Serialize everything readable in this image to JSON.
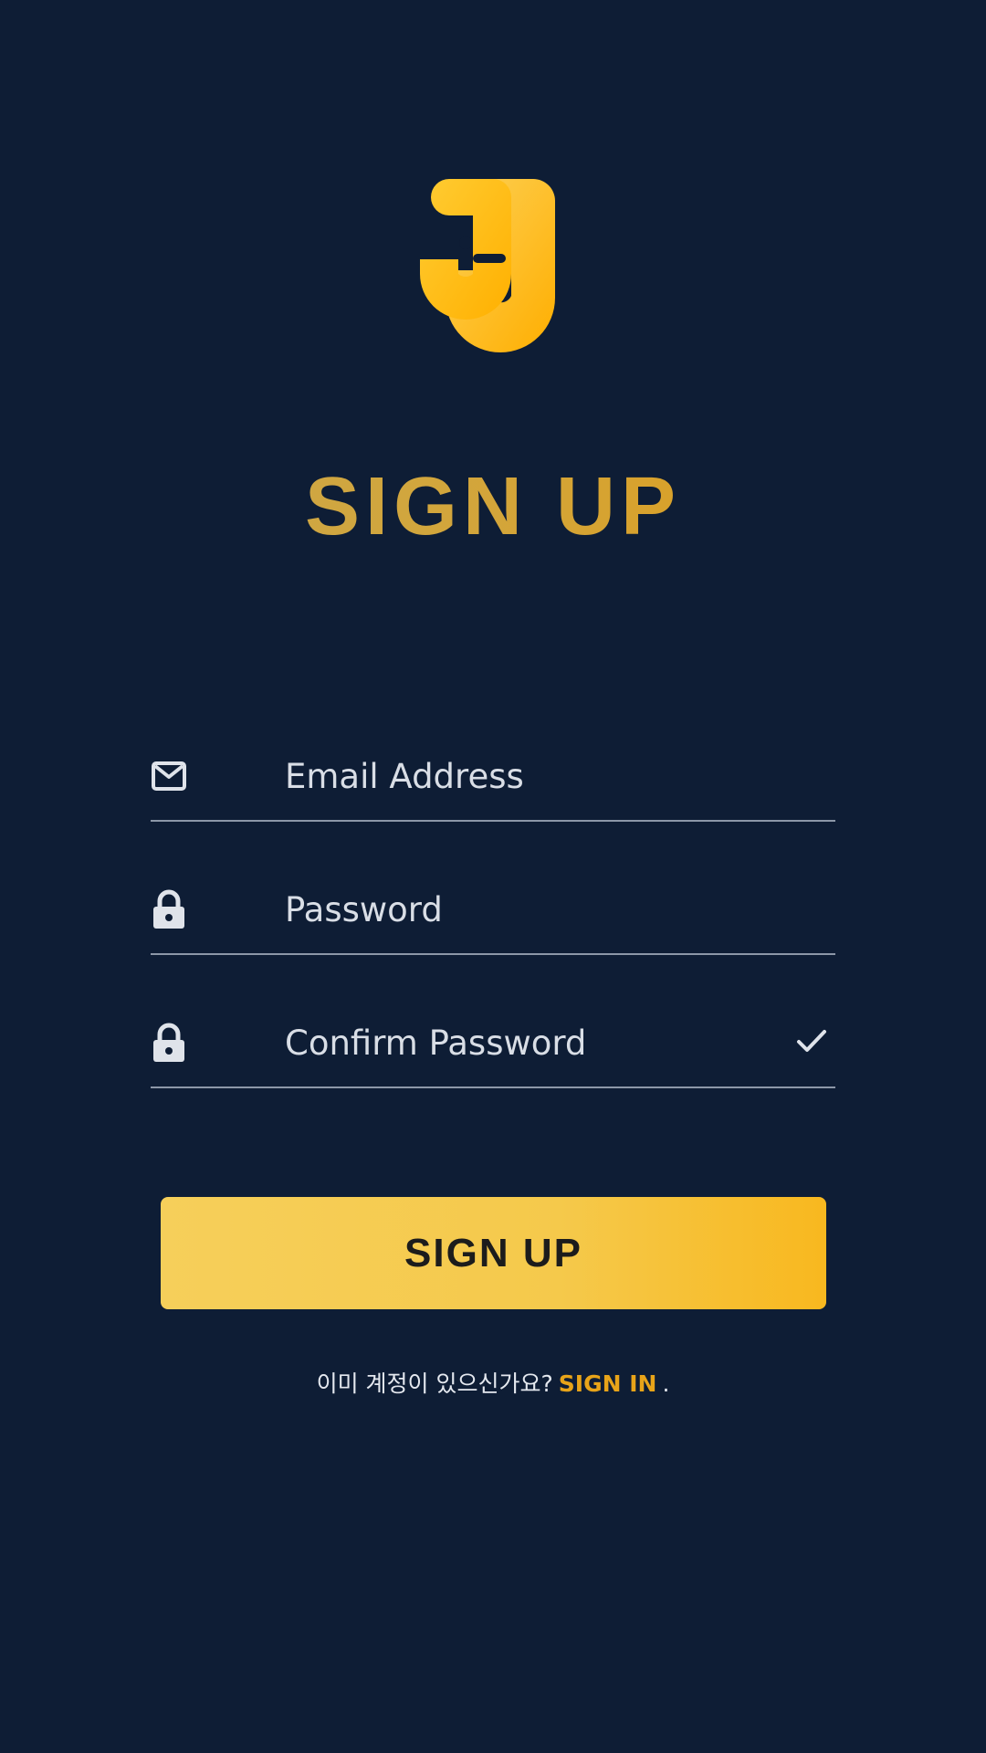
{
  "title": "SIGN UP",
  "form": {
    "email_placeholder": "Email Address",
    "password_placeholder": "Password",
    "confirm_placeholder": "Confirm Password"
  },
  "submit_label": "SIGN UP",
  "footer": {
    "question": "이미 계정이 있으신가요?",
    "signin_label": "SIGN IN",
    "suffix": "."
  },
  "icons": {
    "logo": "jj-logo-icon",
    "email": "mail-icon",
    "password": "lock-icon",
    "confirm": "lock-icon",
    "valid": "check-icon"
  },
  "colors": {
    "background": "#0e1d35",
    "accent": "#f5c94b",
    "link": "#e8a419",
    "divider": "#8c97a8"
  }
}
